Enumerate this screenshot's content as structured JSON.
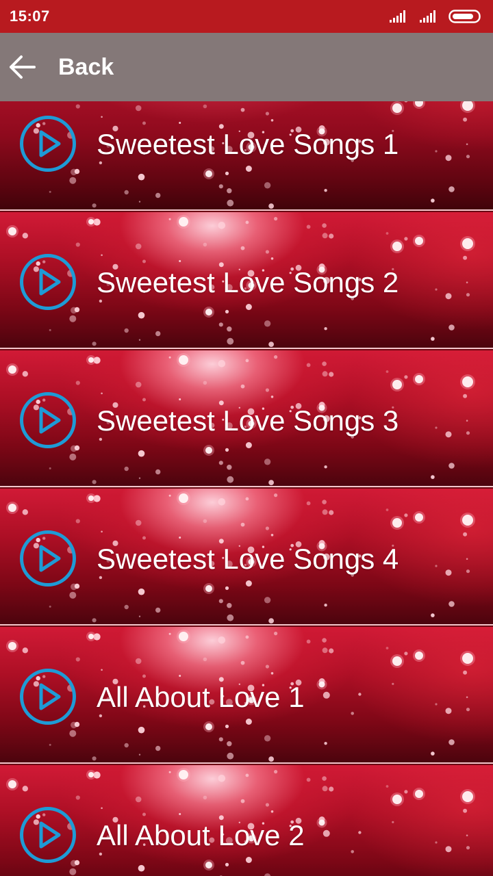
{
  "status_bar": {
    "time": "15:07",
    "icons": [
      "signal-icon",
      "signal-icon",
      "battery-icon"
    ]
  },
  "app_bar": {
    "back_icon": "arrow-left-icon",
    "back_label": "Back"
  },
  "songs": [
    {
      "title": "Sweetest Love Songs 1",
      "icon": "play-icon"
    },
    {
      "title": "Sweetest Love Songs 2",
      "icon": "play-icon"
    },
    {
      "title": "Sweetest Love Songs 3",
      "icon": "play-icon"
    },
    {
      "title": "Sweetest Love Songs 4",
      "icon": "play-icon"
    },
    {
      "title": "All About Love 1",
      "icon": "play-icon"
    },
    {
      "title": "All About Love 2",
      "icon": "play-icon"
    }
  ],
  "colors": {
    "status_bar": "#b81a1f",
    "app_bar": "#847878",
    "play_icon": "#1e9bd6",
    "text": "#ffffff"
  }
}
